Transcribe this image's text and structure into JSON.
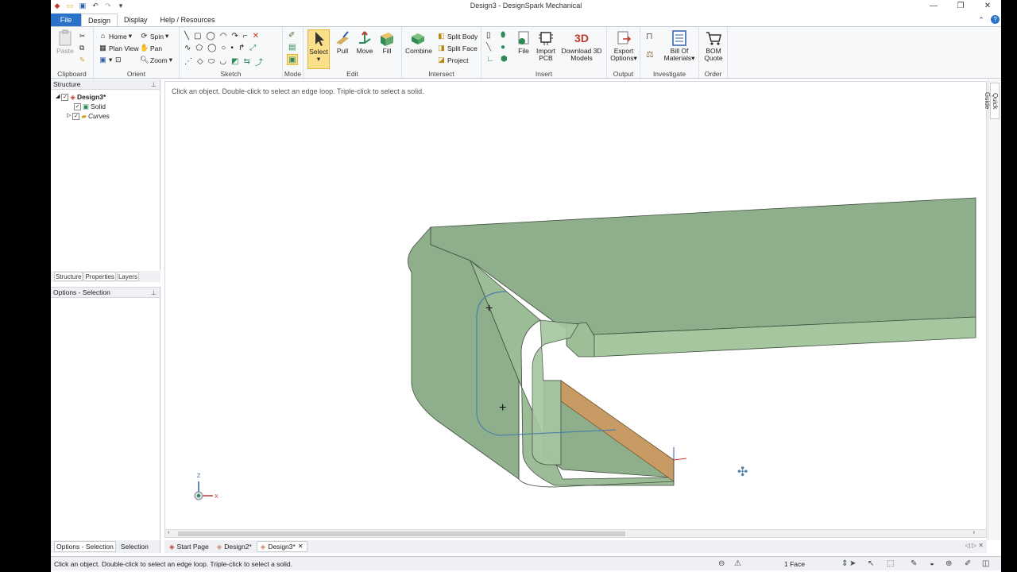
{
  "window": {
    "title": "Design3 - DesignSpark Mechanical",
    "minimize": "—",
    "restore": "❐",
    "close": "✕"
  },
  "ribbon_tabs": [
    "File",
    "Design",
    "Display",
    "Help / Resources"
  ],
  "ribbon": {
    "clipboard": {
      "label": "Clipboard",
      "paste": "Paste"
    },
    "orient": {
      "label": "Orient",
      "home": "Home",
      "spin": "Spin",
      "plan_view": "Plan View",
      "pan": "Pan",
      "zoom": "Zoom"
    },
    "sketch": {
      "label": "Sketch"
    },
    "mode": {
      "label": "Mode"
    },
    "edit": {
      "label": "Edit",
      "select": "Select",
      "pull": "Pull",
      "move": "Move",
      "fill": "Fill"
    },
    "intersect": {
      "label": "Intersect",
      "combine": "Combine",
      "split_body": "Split Body",
      "split_face": "Split Face",
      "project": "Project"
    },
    "insert": {
      "label": "Insert",
      "file": "File",
      "import_pcb": "Import PCB",
      "download_3d": "Download 3D Models",
      "download_3d_icon_text": "3D"
    },
    "output": {
      "label": "Output",
      "export_options": "Export Options"
    },
    "investigate": {
      "label": "Investigate",
      "bill_of_materials": "Bill Of Materials"
    },
    "order": {
      "label": "Order",
      "bom_quote": "BOM Quote"
    }
  },
  "structure_panel": {
    "title": "Structure",
    "tree": [
      {
        "label": "Design3*",
        "level": 0
      },
      {
        "label": "Solid",
        "level": 1
      },
      {
        "label": "Curves",
        "level": 1
      }
    ],
    "tabs": [
      "Structure",
      "Properties",
      "Layers"
    ]
  },
  "options_panel": {
    "title": "Options - Selection"
  },
  "bottom_left_tabs": [
    "Options - Selection",
    "Selection"
  ],
  "viewport": {
    "hint": "Click an object. Double-click to select an edge loop. Triple-click to select a solid.",
    "axis_z": "Z",
    "axis_x": "X"
  },
  "quick_guide": "Quick Guide",
  "doc_tabs": [
    {
      "label": "Start Page",
      "active": false
    },
    {
      "label": "Design2*",
      "active": false
    },
    {
      "label": "Design3*",
      "active": true
    }
  ],
  "status": {
    "text": "Click an object. Double-click to select an edge loop. Triple-click to select a solid.",
    "selection_count": "1 Face"
  },
  "colors": {
    "solid_face": "#8fae8c",
    "solid_light": "#a6c6a0",
    "selected_face": "#c89a64",
    "file_tab": "#2a73c8",
    "select_active": "#fbe08a"
  }
}
